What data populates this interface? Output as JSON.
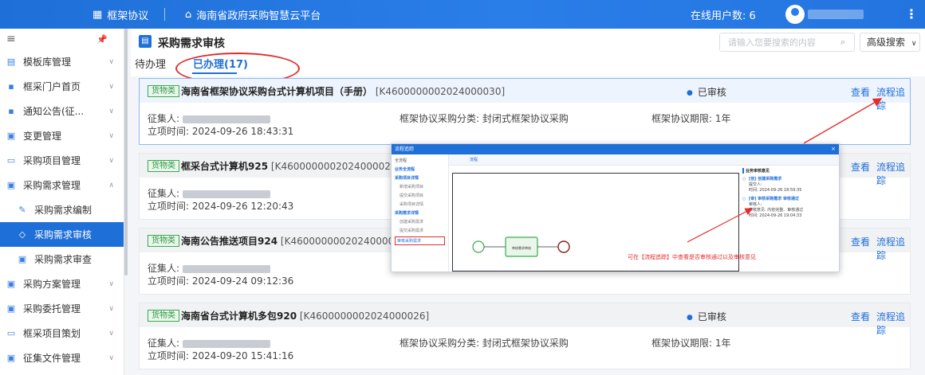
{
  "topbar": {
    "brand": "框架协议",
    "platform": "海南省政府采购智慧云平台",
    "online_label": "在线用户数: 6"
  },
  "sidebar": {
    "items": [
      {
        "label": "模板库管理",
        "icon": "template-icon",
        "expanded": false
      },
      {
        "label": "框采门户首页",
        "icon": "grid-icon",
        "expanded": false
      },
      {
        "label": "通知公告(征...",
        "icon": "grid-icon",
        "expanded": false
      },
      {
        "label": "变更管理",
        "icon": "doc-icon",
        "expanded": false
      },
      {
        "label": "采购项目管理",
        "icon": "folder-icon",
        "expanded": false
      },
      {
        "label": "采购需求管理",
        "icon": "doc-icon",
        "expanded": true
      },
      {
        "label": "采购需求编制",
        "icon": "edit-icon",
        "sub": true
      },
      {
        "label": "采购需求审核",
        "icon": "diamond-icon",
        "sub": true,
        "active": true
      },
      {
        "label": "采购需求审查",
        "icon": "doc-icon",
        "sub": true
      },
      {
        "label": "采购方案管理",
        "icon": "doc-icon",
        "expanded": false
      },
      {
        "label": "采购委托管理",
        "icon": "doc-icon",
        "expanded": false
      },
      {
        "label": "框采项目策划",
        "icon": "folder-icon",
        "expanded": false
      },
      {
        "label": "征集文件管理",
        "icon": "doc-icon",
        "expanded": false
      }
    ]
  },
  "page": {
    "title": "采购需求审核",
    "search_placeholder": "请输入您要搜索的内容",
    "advanced_search": "高级搜索",
    "tabs": [
      "待办理",
      "已办理(17)"
    ]
  },
  "cards": [
    {
      "tag": "货物类",
      "title": "海南省框架协议采购台式计算机项目（手册）",
      "code": "[K4600000002024000030]",
      "status": "已审核",
      "view": "查看",
      "trace": "流程追踪",
      "collector_label": "征集人:",
      "time_label": "立项时间: 2024-09-26 18:43:31",
      "category": "框架协议采购分类: 封闭式框架协议采购",
      "period": "框架协议期限: 1年"
    },
    {
      "tag": "货物类",
      "title": "框采台式计算机925",
      "code": "[K4600000002024000029]",
      "status": "",
      "view": "查看",
      "trace": "流程追踪",
      "collector_label": "征集人:",
      "time_label": "立项时间: 2024-09-26 12:20:43",
      "category": "",
      "period": ""
    },
    {
      "tag": "货物类",
      "title": "海南公告推送项目924",
      "code": "[K4600000002024000028]",
      "status": "",
      "view": "查看",
      "trace": "流程追踪",
      "collector_label": "征集人:",
      "time_label": "立项时间: 2024-09-24 09:12:36",
      "category": "",
      "period": ""
    },
    {
      "tag": "货物类",
      "title": "海南省台式计算机多包920",
      "code": "[K4600000002024000026]",
      "status": "已审核",
      "view": "查看",
      "trace": "流程追踪",
      "collector_label": "征集人:",
      "time_label": "立项时间: 2024-09-20 15:41:16",
      "category": "框架协议采购分类: 封闭式框架协议采购",
      "period": "框架协议期限: 1年"
    }
  ],
  "popup": {
    "title": "流程追踪",
    "tab": "流程",
    "left": {
      "label_all": "全流程",
      "label_main": "业务全流程",
      "group1": "采购项目详情",
      "g1_items": [
        "新增采购项目",
        "提交采购项目",
        "采购项目详情"
      ],
      "group2": "采购需求详情",
      "g2_items": [
        "创建采购需求",
        "提交采购需求"
      ],
      "highlight": "审核采购需求"
    },
    "node_label": "审核需求审核",
    "right": {
      "title": "业务审核意见",
      "items": [
        {
          "head": "[创] 创建采购需求",
          "lines": [
            "提交人:",
            "时间: 2024-09-26 18:59:35"
          ]
        },
        {
          "head": "[审] 审核采购需求 审核通过",
          "lines": [
            "审核人:",
            "审核意见: 内容完整、审核通过",
            "时间: 2024-09-26 19:04:33"
          ]
        }
      ]
    },
    "note": "可在【流程追踪】中查看是否审核通过以及审核意见"
  },
  "colors": {
    "primary": "#1f6fd8",
    "tag_green": "#2f9944",
    "annotation_red": "#e42b2b"
  }
}
